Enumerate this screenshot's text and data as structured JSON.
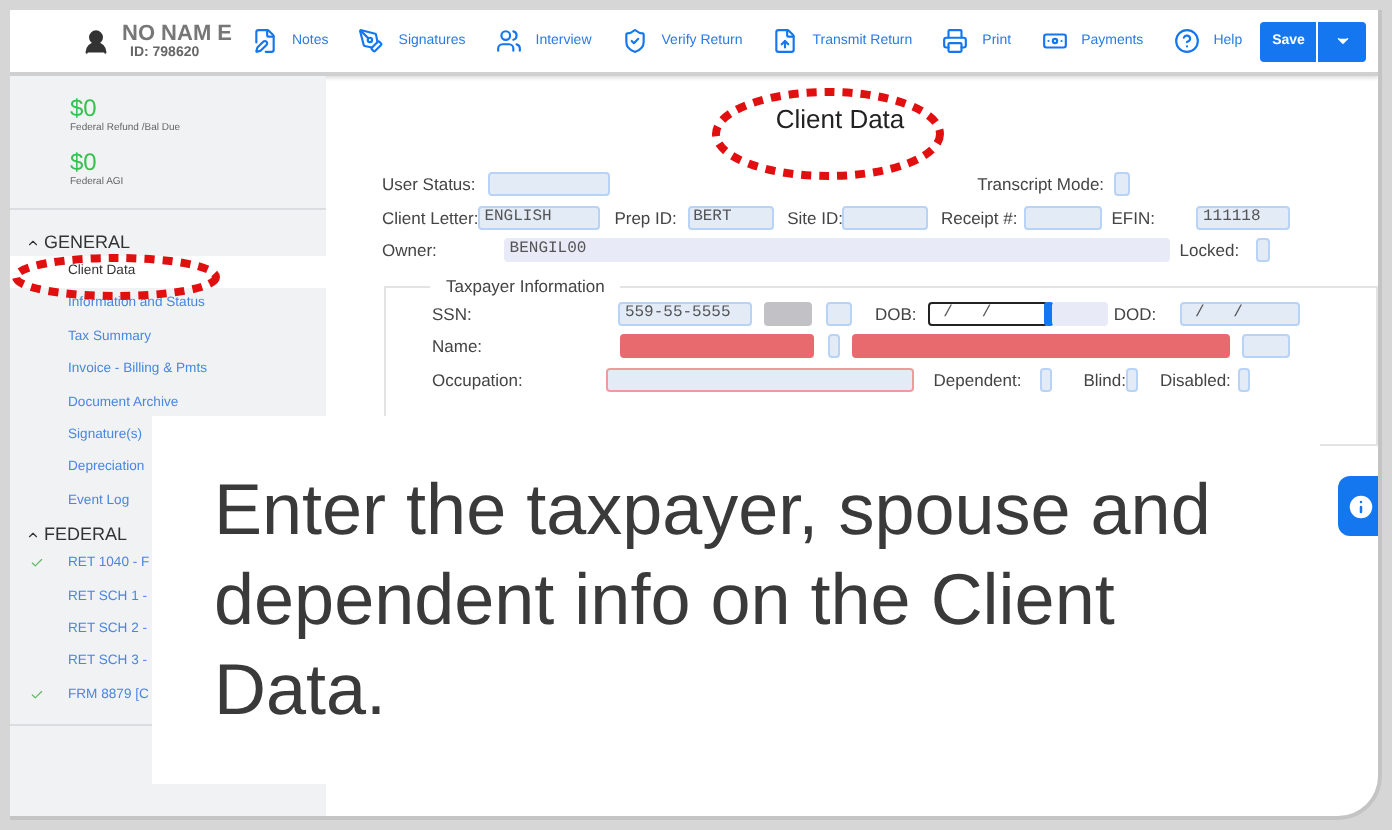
{
  "header": {
    "client_name": "NO NAM E",
    "client_id": "ID: 798620"
  },
  "toolbar": [
    {
      "label": "Notes"
    },
    {
      "label": "Signatures"
    },
    {
      "label": "Interview"
    },
    {
      "label": "Verify Return"
    },
    {
      "label": "Transmit Return"
    },
    {
      "label": "Print"
    },
    {
      "label": "Payments"
    },
    {
      "label": "Help"
    }
  ],
  "save_button": "Save",
  "summary": [
    {
      "amount": "$0",
      "label": "Federal Refund /Bal Due"
    },
    {
      "amount": "$0",
      "label": "Federal AGI"
    }
  ],
  "sections": [
    {
      "title": "GENERAL",
      "expanded": true,
      "items": [
        {
          "label": "Client Data",
          "selected": true,
          "checked": false
        },
        {
          "label": "Information and Status",
          "selected": false,
          "checked": false
        },
        {
          "label": "Tax Summary",
          "selected": false,
          "checked": false
        },
        {
          "label": "Invoice - Billing & Pmts",
          "selected": false,
          "checked": false
        },
        {
          "label": "Document Archive",
          "selected": false,
          "checked": false
        },
        {
          "label": "Signature(s)",
          "selected": false,
          "checked": false
        },
        {
          "label": "Depreciation",
          "selected": false,
          "checked": false
        },
        {
          "label": "Event Log",
          "selected": false,
          "checked": false
        }
      ]
    },
    {
      "title": "FEDERAL",
      "expanded": true,
      "items": [
        {
          "label": "RET 1040 - F",
          "selected": false,
          "checked": true
        },
        {
          "label": "RET SCH 1 -",
          "selected": false,
          "checked": false
        },
        {
          "label": "RET SCH 2 -",
          "selected": false,
          "checked": false
        },
        {
          "label": "RET SCH 3 -",
          "selected": false,
          "checked": false
        },
        {
          "label": "FRM 8879 [C",
          "selected": false,
          "checked": true
        }
      ]
    }
  ],
  "page_title": "Client Data",
  "client_rows": [
    [
      {
        "kind": "label",
        "text": "User Status:"
      },
      {
        "kind": "field"
      },
      {
        "kind": "label",
        "text": "Transcript Mode:"
      },
      {
        "kind": "checkbox",
        "checked": false
      }
    ],
    [
      {
        "kind": "label",
        "text": "Client Letter:"
      },
      {
        "kind": "field",
        "value": "ENGLISH"
      },
      {
        "kind": "label",
        "text": "Prep ID:"
      },
      {
        "kind": "field",
        "value": "BERT"
      },
      {
        "kind": "label",
        "text": "Site ID:"
      },
      {
        "kind": "field"
      },
      {
        "kind": "label",
        "text": "Receipt #:"
      },
      {
        "kind": "field"
      },
      {
        "kind": "label",
        "text": "EFIN:"
      },
      {
        "kind": "field",
        "value": "111118"
      }
    ],
    [
      {
        "kind": "label",
        "text": "Owner:"
      },
      {
        "kind": "readonly_field",
        "value": "BENGIL00"
      },
      {
        "kind": "label",
        "text": "Locked:"
      },
      {
        "kind": "checkbox",
        "checked": false
      }
    ]
  ],
  "taxpayer": {
    "legend": "Taxpayer Information",
    "rows": [
      [
        {
          "kind": "label",
          "text": "SSN:"
        },
        {
          "kind": "field",
          "value": "559-55-5555"
        },
        {
          "kind": "locked_field"
        },
        {
          "kind": "field"
        },
        {
          "kind": "label",
          "text": "DOB:"
        },
        {
          "kind": "date_field",
          "value": " /   /",
          "focused": true
        },
        {
          "kind": "readonly_field"
        },
        {
          "kind": "label",
          "text": "DOD:"
        },
        {
          "kind": "field",
          "value": " /   /"
        }
      ],
      [
        {
          "kind": "label",
          "text": "Name:"
        },
        {
          "kind": "required_field"
        },
        {
          "kind": "field"
        },
        {
          "kind": "required_field"
        },
        {
          "kind": "field"
        }
      ],
      [
        {
          "kind": "label",
          "text": "Occupation:"
        },
        {
          "kind": "invalid_field"
        },
        {
          "kind": "label",
          "text": "Dependent:"
        },
        {
          "kind": "checkbox",
          "checked": false
        },
        {
          "kind": "label",
          "text": "Blind:"
        },
        {
          "kind": "checkbox",
          "checked": false
        },
        {
          "kind": "label",
          "text": "Disabled:"
        },
        {
          "kind": "checkbox",
          "checked": false
        }
      ]
    ]
  },
  "callout": {
    "text": "Enter the taxpayer, spouse and dependent info on the Client Data."
  }
}
